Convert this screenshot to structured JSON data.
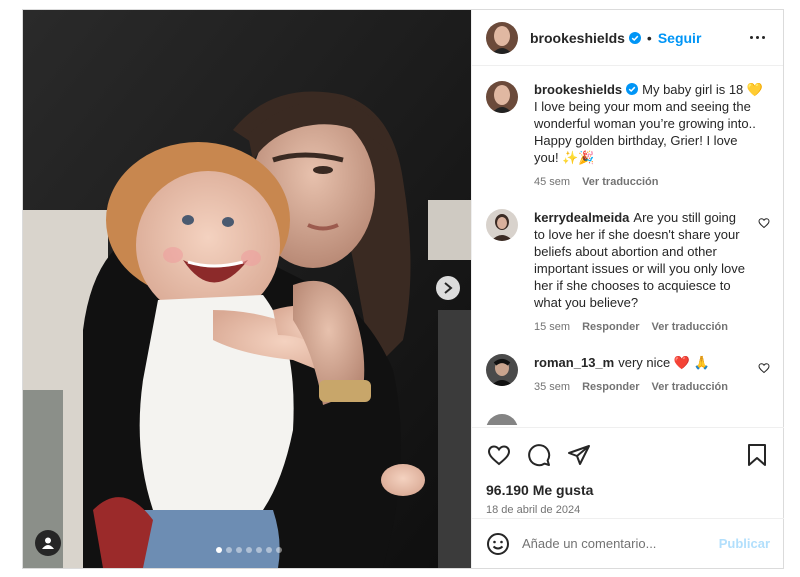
{
  "post": {
    "username": "brookeshields",
    "follow_label": "Seguir",
    "separator": "•",
    "carousel": {
      "total_slides": 7,
      "active_index": 0
    }
  },
  "caption": {
    "username": "brookeshields",
    "text": "My baby girl is 18 💛 I love being your mom and seeing the wonderful woman you’re growing into.. Happy golden birthday, Grier! I love you! ✨🎉",
    "time": "45 sem",
    "translate": "Ver traducción"
  },
  "comments": [
    {
      "username": "kerrydealmeida",
      "text": "Are you still going to love her if she doesn't share your beliefs about abortion and other important issues or will you only love her if she chooses to acquiesce to what you believe?",
      "time": "15 sem",
      "reply": "Responder",
      "translate": "Ver traducción"
    },
    {
      "username": "roman_13_m",
      "text": "very nice ❤️ 🙏",
      "time": "35 sem",
      "reply": "Responder",
      "translate": "Ver traducción"
    }
  ],
  "stats": {
    "likes": "96.190 Me gusta",
    "date": "18 de abril de 2024"
  },
  "composer": {
    "placeholder": "Añade un comentario...",
    "publish": "Publicar"
  },
  "icons": {
    "like": "heart-icon",
    "comment": "comment-icon",
    "share": "share-icon",
    "save": "bookmark-icon",
    "emoji": "emoji-icon",
    "verified": "verified-badge-icon",
    "next": "chevron-right-icon",
    "tags": "user-tag-icon"
  },
  "colors": {
    "accent": "#0095f6",
    "publish_disabled": "#b2dffc",
    "like_red": "#ed4956"
  }
}
